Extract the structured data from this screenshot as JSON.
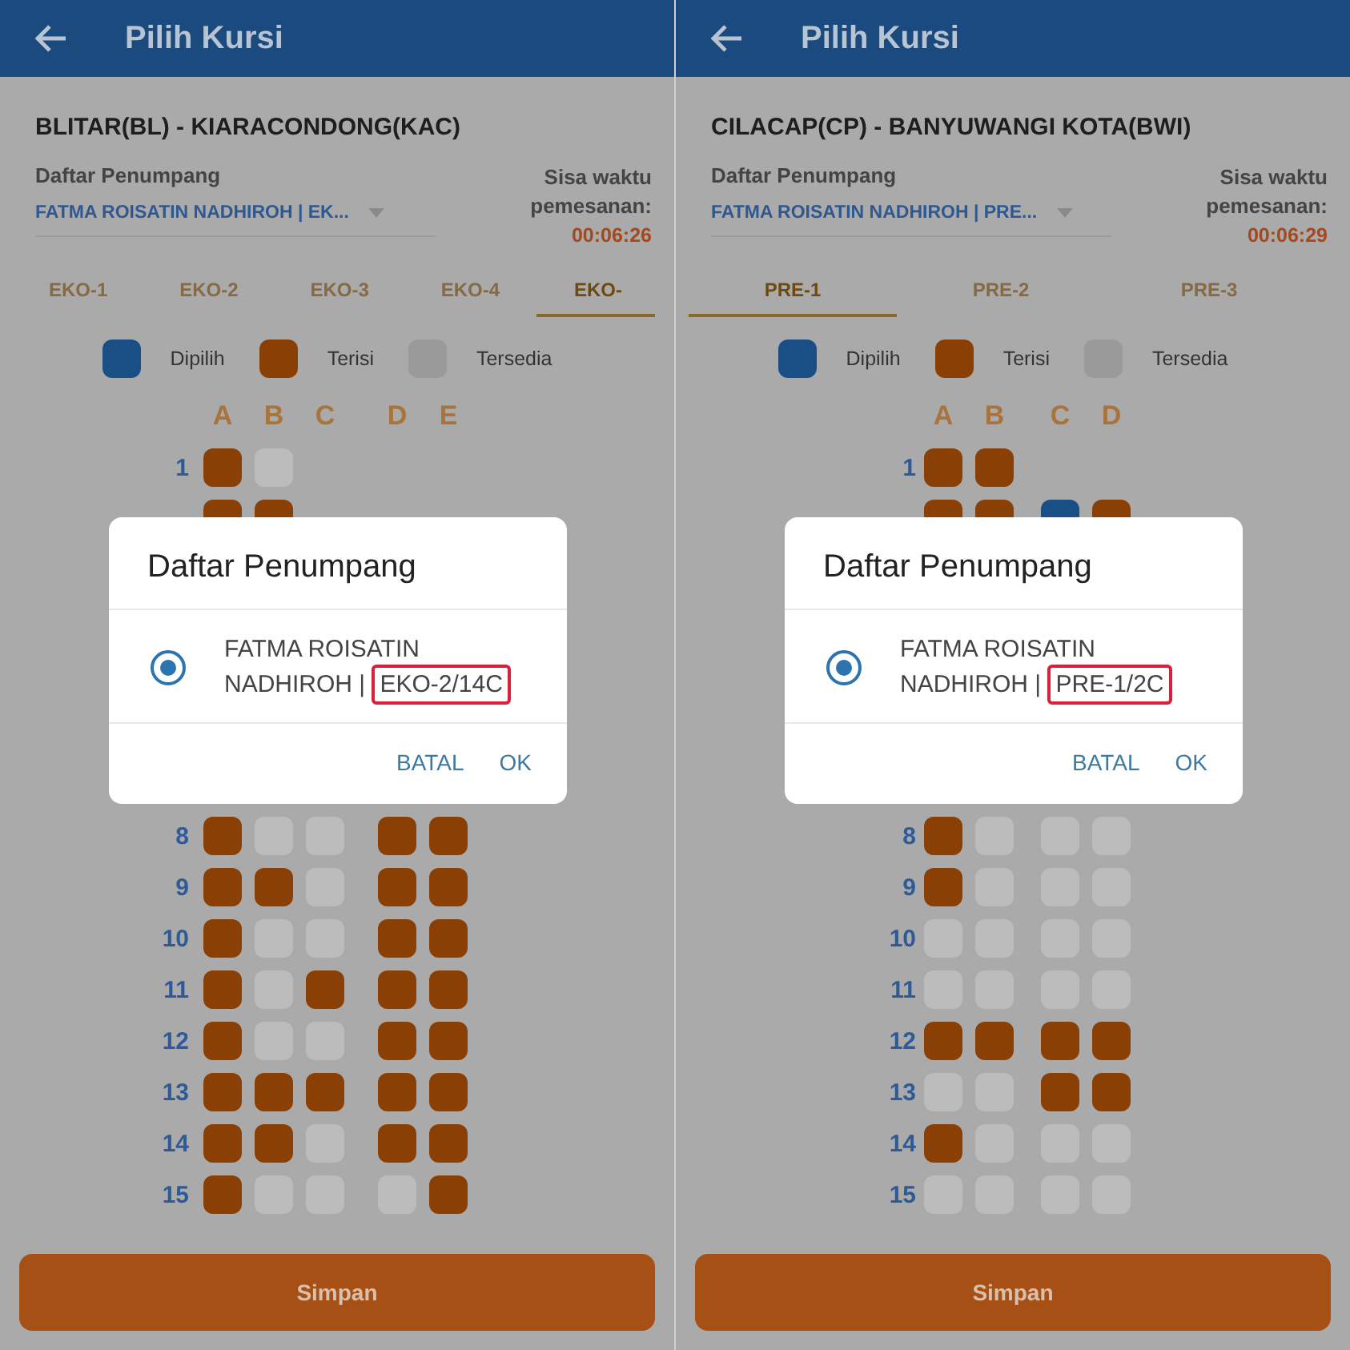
{
  "panels": [
    {
      "header": {
        "title": "Pilih Kursi"
      },
      "route": "BLITAR(BL) - KIARACONDONG(KAC)",
      "passenger_label": "Daftar Penumpang",
      "passenger_value": "FATMA ROISATIN NADHIROH | EK...",
      "timer_label": "Sisa waktu pemesanan:",
      "timer": "00:06:26",
      "tabs": [
        {
          "label": "EKO-1",
          "selected": false
        },
        {
          "label": "EKO-2",
          "selected": false
        },
        {
          "label": "EKO-3",
          "selected": false
        },
        {
          "label": "EKO-4",
          "selected": false
        },
        {
          "label": "EKO-",
          "selected": true
        }
      ],
      "legend": [
        {
          "label": "Dipilih",
          "color": "#1a4f85"
        },
        {
          "label": "Terisi",
          "color": "#8a4005"
        },
        {
          "label": "Tersedia",
          "color": "#9a9a9a"
        }
      ],
      "column_groups": [
        [
          "A",
          "B",
          "C"
        ],
        [
          "D",
          "E"
        ]
      ],
      "rows_above_dialog": [
        {
          "label": "1",
          "seats": [
            {
              "color": "#8a4005"
            },
            {
              "color": "#bcbcbc"
            }
          ]
        },
        {
          "seats": [
            {
              "color": "#8a4005"
            },
            {
              "color": "#8a4005"
            }
          ]
        }
      ],
      "rows_below_dialog": [
        {
          "label": "8",
          "seats": [
            {
              "color": "#8a4005"
            },
            {
              "color": "#bcbcbc"
            },
            {
              "color": "#bcbcbc"
            },
            {
              "color": "#8a4005"
            },
            {
              "color": "#8a4005"
            }
          ]
        },
        {
          "label": "9",
          "seats": [
            {
              "color": "#8a4005"
            },
            {
              "color": "#8a4005"
            },
            {
              "color": "#bcbcbc"
            },
            {
              "color": "#8a4005"
            },
            {
              "color": "#8a4005"
            }
          ]
        },
        {
          "label": "10",
          "seats": [
            {
              "color": "#8a4005"
            },
            {
              "color": "#bcbcbc"
            },
            {
              "color": "#bcbcbc"
            },
            {
              "color": "#8a4005"
            },
            {
              "color": "#8a4005"
            }
          ]
        },
        {
          "label": "11",
          "seats": [
            {
              "color": "#8a4005"
            },
            {
              "color": "#bcbcbc"
            },
            {
              "color": "#8a4005"
            },
            {
              "color": "#8a4005"
            },
            {
              "color": "#8a4005"
            }
          ]
        },
        {
          "label": "12",
          "seats": [
            {
              "color": "#8a4005"
            },
            {
              "color": "#bcbcbc"
            },
            {
              "color": "#bcbcbc"
            },
            {
              "color": "#8a4005"
            },
            {
              "color": "#8a4005"
            }
          ]
        },
        {
          "label": "13",
          "seats": [
            {
              "color": "#8a4005"
            },
            {
              "color": "#8a4005"
            },
            {
              "color": "#8a4005"
            },
            {
              "color": "#8a4005"
            },
            {
              "color": "#8a4005"
            }
          ]
        },
        {
          "label": "14",
          "seats": [
            {
              "color": "#8a4005"
            },
            {
              "color": "#8a4005"
            },
            {
              "color": "#bcbcbc"
            },
            {
              "color": "#8a4005"
            },
            {
              "color": "#8a4005"
            }
          ]
        },
        {
          "label": "15",
          "seats": [
            {
              "color": "#8a4005"
            },
            {
              "color": "#bcbcbc"
            },
            {
              "color": "#bcbcbc"
            },
            {
              "color": "#bcbcbc"
            },
            {
              "color": "#8a4005"
            }
          ]
        }
      ],
      "save_button": "Simpan",
      "dialog": {
        "title": "Daftar Penumpang",
        "options": [
          {
            "name": "FATMA ROISATIN NADHIROH |",
            "seat": "EKO-2/14C",
            "selected": true
          }
        ],
        "buttons": [
          "BATAL",
          "OK"
        ]
      }
    },
    {
      "header": {
        "title": "Pilih Kursi"
      },
      "route": "CILACAP(CP) - BANYUWANGI KOTA(BWI)",
      "passenger_label": "Daftar Penumpang",
      "passenger_value": "FATMA ROISATIN NADHIROH | PRE...",
      "timer_label": "Sisa waktu pemesanan:",
      "timer": "00:06:29",
      "tabs": [
        {
          "label": "PRE-1",
          "selected": true
        },
        {
          "label": "PRE-2",
          "selected": false
        },
        {
          "label": "PRE-3",
          "selected": false
        }
      ],
      "legend": [
        {
          "label": "Dipilih",
          "color": "#1a4f85"
        },
        {
          "label": "Terisi",
          "color": "#8a4005"
        },
        {
          "label": "Tersedia",
          "color": "#9a9a9a"
        }
      ],
      "column_groups": [
        [
          "A",
          "B"
        ],
        [
          "C",
          "D"
        ]
      ],
      "rows_above_dialog": [
        {
          "label": "1",
          "seats": [
            {
              "color": "#8a4005"
            },
            {
              "color": "#8a4005"
            }
          ]
        },
        {
          "seats": [
            {
              "color": "#8a4005"
            },
            {
              "color": "#8a4005"
            },
            {
              "color": "#1a4f85"
            },
            {
              "color": "#8a4005"
            }
          ]
        }
      ],
      "rows_below_dialog": [
        {
          "label": "8",
          "seats": [
            {
              "color": "#8a4005"
            },
            {
              "color": "#bcbcbc"
            },
            {
              "color": "#bcbcbc"
            },
            {
              "color": "#bcbcbc"
            }
          ]
        },
        {
          "label": "9",
          "seats": [
            {
              "color": "#8a4005"
            },
            {
              "color": "#bcbcbc"
            },
            {
              "color": "#bcbcbc"
            },
            {
              "color": "#bcbcbc"
            }
          ]
        },
        {
          "label": "10",
          "seats": [
            {
              "color": "#bcbcbc"
            },
            {
              "color": "#bcbcbc"
            },
            {
              "color": "#bcbcbc"
            },
            {
              "color": "#bcbcbc"
            }
          ]
        },
        {
          "label": "11",
          "seats": [
            {
              "color": "#bcbcbc"
            },
            {
              "color": "#bcbcbc"
            },
            {
              "color": "#bcbcbc"
            },
            {
              "color": "#bcbcbc"
            }
          ]
        },
        {
          "label": "12",
          "seats": [
            {
              "color": "#8a4005"
            },
            {
              "color": "#8a4005"
            },
            {
              "color": "#8a4005"
            },
            {
              "color": "#8a4005"
            }
          ]
        },
        {
          "label": "13",
          "seats": [
            {
              "color": "#bcbcbc"
            },
            {
              "color": "#bcbcbc"
            },
            {
              "color": "#8a4005"
            },
            {
              "color": "#8a4005"
            }
          ]
        },
        {
          "label": "14",
          "seats": [
            {
              "color": "#8a4005"
            },
            {
              "color": "#bcbcbc"
            },
            {
              "color": "#bcbcbc"
            },
            {
              "color": "#bcbcbc"
            }
          ]
        },
        {
          "label": "15",
          "seats": [
            {
              "color": "#bcbcbc"
            },
            {
              "color": "#bcbcbc"
            },
            {
              "color": "#bcbcbc"
            },
            {
              "color": "#bcbcbc"
            }
          ]
        }
      ],
      "save_button": "Simpan",
      "dialog": {
        "title": "Daftar Penumpang",
        "options": [
          {
            "name": "FATMA ROISATIN NADHIROH |",
            "seat": "PRE-1/2C",
            "selected": true
          }
        ],
        "buttons": [
          "BATAL",
          "OK"
        ]
      }
    }
  ]
}
